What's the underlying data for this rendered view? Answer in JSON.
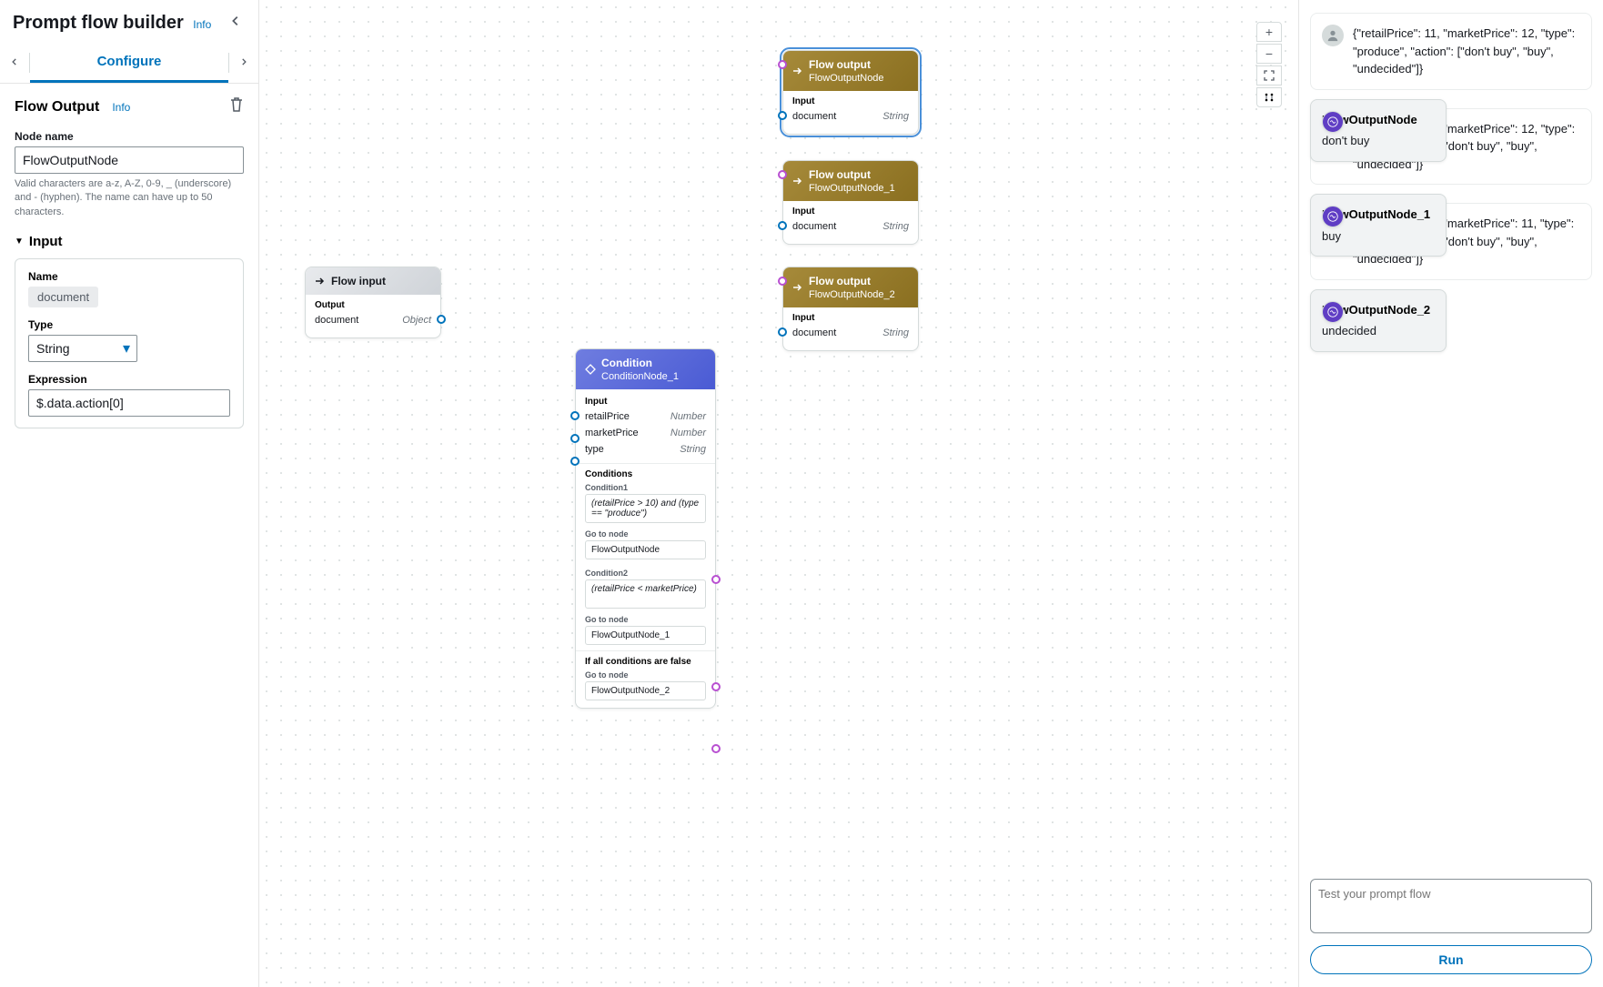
{
  "header": {
    "title": "Prompt flow builder",
    "info": "Info"
  },
  "tabs": {
    "configure": "Configure"
  },
  "panel": {
    "title": "Flow Output",
    "info": "Info",
    "nodeNameLabel": "Node name",
    "nodeNameValue": "FlowOutputNode",
    "nodeNameHelp": "Valid characters are a-z, A-Z, 0-9, _ (underscore) and - (hyphen). The name can have up to 50 characters.",
    "inputSection": "Input",
    "sub": {
      "nameLabel": "Name",
      "namePill": "document",
      "typeLabel": "Type",
      "typeValue": "String",
      "exprLabel": "Expression",
      "exprValue": "$.data.action[0]"
    }
  },
  "canvas": {
    "flowInput": {
      "headTitle": "Flow input",
      "bodyLabel": "Output",
      "rowName": "document",
      "rowType": "Object"
    },
    "outputs": [
      {
        "headTitle": "Flow output",
        "headSub": "FlowOutputNode",
        "bodyLabel": "Input",
        "rowName": "document",
        "rowType": "String"
      },
      {
        "headTitle": "Flow output",
        "headSub": "FlowOutputNode_1",
        "bodyLabel": "Input",
        "rowName": "document",
        "rowType": "String"
      },
      {
        "headTitle": "Flow output",
        "headSub": "FlowOutputNode_2",
        "bodyLabel": "Input",
        "rowName": "document",
        "rowType": "String"
      }
    ],
    "condition": {
      "headTitle": "Condition",
      "headSub": "ConditionNode_1",
      "bodyLabel": "Input",
      "inputs": [
        {
          "name": "retailPrice",
          "type": "Number"
        },
        {
          "name": "marketPrice",
          "type": "Number"
        },
        {
          "name": "type",
          "type": "String"
        }
      ],
      "conditionsTitle": "Conditions",
      "cond1Label": "Condition1",
      "cond1Expr": "(retailPrice > 10) and (type == \"produce\")",
      "gotoLabel": "Go to node",
      "goto1": "FlowOutputNode",
      "cond2Label": "Condition2",
      "cond2Expr": "(retailPrice < marketPrice)",
      "goto2": "FlowOutputNode_1",
      "elseLabel": "If all conditions are false",
      "goto3": "FlowOutputNode_2"
    }
  },
  "test": {
    "messages": [
      {
        "kind": "user",
        "text": "{\"retailPrice\": 11, \"marketPrice\": 12, \"type\": \"produce\", \"action\": [\"don't buy\", \"buy\", \"undecided\"]}"
      },
      {
        "kind": "node",
        "title": "FlowOutputNode",
        "text": "don't buy"
      },
      {
        "kind": "user",
        "text": "{\"retailPrice\": 11, \"marketPrice\": 12, \"type\": \"meat\", \"action\": [\"don't buy\", \"buy\", \"undecided\"]}"
      },
      {
        "kind": "node",
        "title": "FlowOutputNode_1",
        "text": "buy"
      },
      {
        "kind": "user",
        "text": "{\"retailPrice\": 11, \"marketPrice\": 11, \"type\": \"meat\", \"action\": [\"don't buy\", \"buy\", \"undecided\"]}"
      },
      {
        "kind": "node",
        "title": "FlowOutputNode_2",
        "text": "undecided"
      }
    ],
    "placeholder": "Test your prompt flow",
    "runLabel": "Run"
  }
}
